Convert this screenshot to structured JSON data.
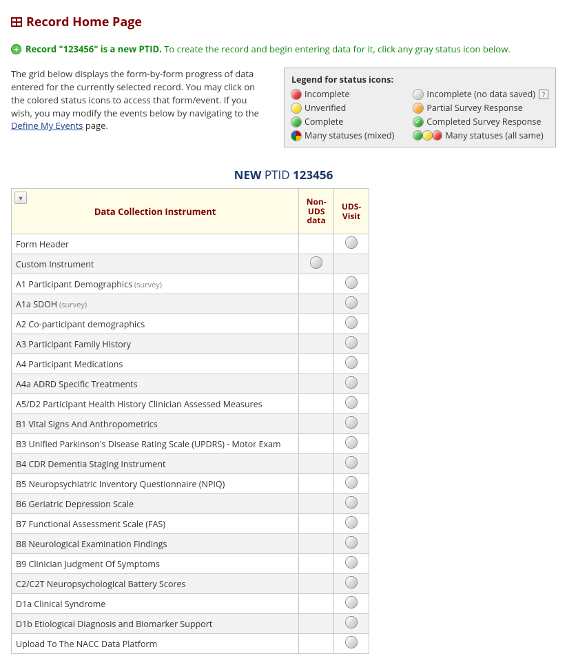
{
  "page": {
    "title": "Record Home Page",
    "banner_bold": "Record \"123456\" is a new PTID.",
    "banner_rest": "To create the record and begin entering data for it, click any gray status icon below.",
    "intro_a": "The grid below displays the form-by-form progress of data entered for the currently selected record. You may click on the colored status icons to access that form/event. If you wish, you may modify the events below by navigating to the ",
    "intro_link": "Define My Events",
    "intro_b": " page."
  },
  "legend": {
    "title": "Legend for status icons:",
    "items": {
      "incomplete": "Incomplete",
      "incomplete_nodata": "Incomplete (no data saved)",
      "unverified": "Unverified",
      "partial": "Partial Survey Response",
      "complete": "Complete",
      "completed_survey": "Completed Survey Response",
      "many_mixed": "Many statuses (mixed)",
      "many_same": "Many statuses (all same)"
    }
  },
  "ptid": {
    "new_label": "NEW",
    "ptid_label": "PTID",
    "id": "123456"
  },
  "grid": {
    "header_instrument": "Data Collection Instrument",
    "header_nonuds": "Non-UDS data",
    "header_uds": "UDS-Visit",
    "rows": [
      {
        "name": "Form Header",
        "survey": false,
        "nonuds": false,
        "uds": true
      },
      {
        "name": "Custom Instrument",
        "survey": false,
        "nonuds": true,
        "uds": false
      },
      {
        "name": "A1 Participant Demographics",
        "survey": true,
        "nonuds": false,
        "uds": true
      },
      {
        "name": "A1a SDOH",
        "survey": true,
        "nonuds": false,
        "uds": true
      },
      {
        "name": "A2 Co-participant demographics",
        "survey": false,
        "nonuds": false,
        "uds": true
      },
      {
        "name": "A3 Participant Family History",
        "survey": false,
        "nonuds": false,
        "uds": true
      },
      {
        "name": "A4 Participant Medications",
        "survey": false,
        "nonuds": false,
        "uds": true
      },
      {
        "name": "A4a ADRD Specific Treatments",
        "survey": false,
        "nonuds": false,
        "uds": true
      },
      {
        "name": "A5/D2 Participant Health History Clinician Assessed Measures",
        "survey": false,
        "nonuds": false,
        "uds": true
      },
      {
        "name": "B1 Vital Signs And Anthropometrics",
        "survey": false,
        "nonuds": false,
        "uds": true
      },
      {
        "name": "B3 Unified Parkinson's Disease Rating Scale (UPDRS) - Motor Exam",
        "survey": false,
        "nonuds": false,
        "uds": true
      },
      {
        "name": "B4 CDR Dementia Staging Instrument",
        "survey": false,
        "nonuds": false,
        "uds": true
      },
      {
        "name": "B5 Neuropsychiatric Inventory Questionnaire (NPIQ)",
        "survey": false,
        "nonuds": false,
        "uds": true
      },
      {
        "name": "B6 Geriatric Depression Scale",
        "survey": false,
        "nonuds": false,
        "uds": true
      },
      {
        "name": "B7 Functional Assessment Scale (FAS)",
        "survey": false,
        "nonuds": false,
        "uds": true
      },
      {
        "name": "B8 Neurological Examination Findings",
        "survey": false,
        "nonuds": false,
        "uds": true
      },
      {
        "name": "B9 Clinician Judgment Of Symptoms",
        "survey": false,
        "nonuds": false,
        "uds": true
      },
      {
        "name": "C2/C2T Neuropsychological Battery Scores",
        "survey": false,
        "nonuds": false,
        "uds": true
      },
      {
        "name": "D1a Clinical Syndrome",
        "survey": false,
        "nonuds": false,
        "uds": true
      },
      {
        "name": "D1b Etiological Diagnosis and Biomarker Support",
        "survey": false,
        "nonuds": false,
        "uds": true
      },
      {
        "name": "Upload To The NACC Data Platform",
        "survey": false,
        "nonuds": false,
        "uds": true
      }
    ]
  },
  "labels": {
    "survey_tag": "(survey)"
  }
}
